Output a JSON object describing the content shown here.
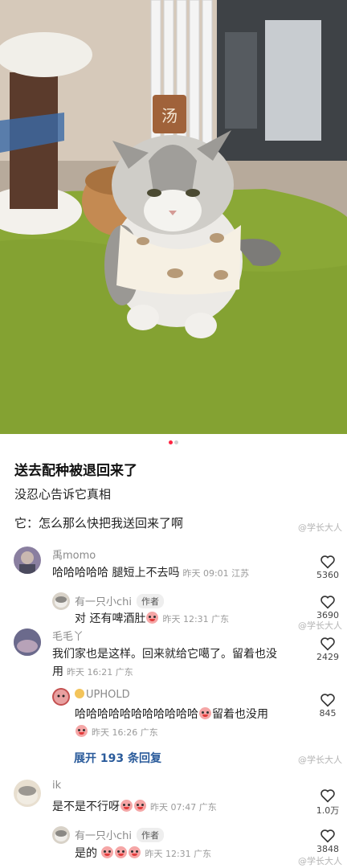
{
  "photo": {
    "carousel_count": 2,
    "active_index": 0,
    "sign_char": "汤"
  },
  "post": {
    "title": "送去配种被退回来了",
    "line1": "没忍心告诉它真相",
    "line2": "它：怎么那么快把我送回来了啊"
  },
  "watermark": "@学长大人",
  "comments": [
    {
      "user": "禹momo",
      "text": "哈哈哈哈哈 腿短上不去吗",
      "meta": "昨天 09:01 江苏",
      "likes": "5360",
      "reply": {
        "user": "有一只小chi",
        "tag": "作者",
        "text": "对 还有啤酒肚",
        "meta": "昨天 12:31 广东",
        "likes": "3690"
      }
    },
    {
      "user": "毛毛丫",
      "text1": "我们家也是这样。回来就给它噶了。留着也没",
      "text2": "用",
      "meta": "昨天 16:21 广东",
      "likes": "2429",
      "reply": {
        "user": "UPHOLD",
        "text": "哈哈哈哈哈哈哈哈哈哈哈",
        "text_after": "留着也没用",
        "meta": "昨天 16:26 广东",
        "likes": "845"
      },
      "expand": "展开 193 条回复"
    },
    {
      "user": "ik",
      "text": "是不是不行呀",
      "meta": "昨天 07:47 广东",
      "likes": "1.0万",
      "reply": {
        "user": "有一只小chi",
        "tag": "作者",
        "text": "是的",
        "meta": "昨天 12:31 广东",
        "likes": "3848"
      }
    }
  ],
  "colors": {
    "accent": "#ff2442",
    "link": "#2a5b9b",
    "rug": "#8aa836"
  }
}
